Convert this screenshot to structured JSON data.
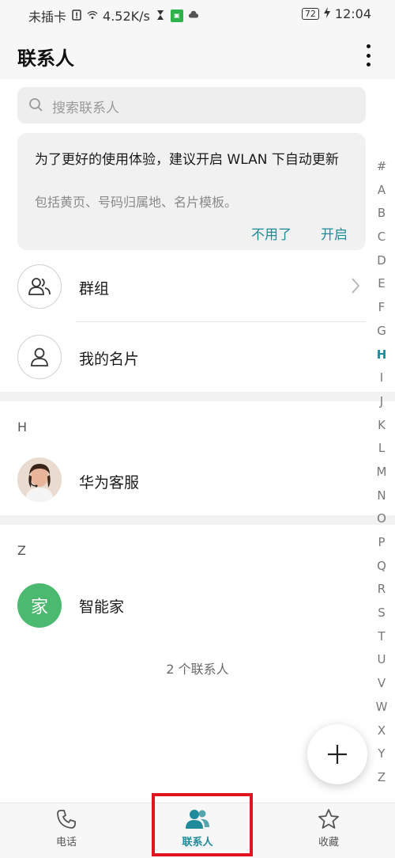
{
  "status_bar": {
    "carrier": "未插卡",
    "speed": "4.52K/s",
    "battery": "72",
    "time": "12:04"
  },
  "header": {
    "title": "联系人",
    "menu_icon": "more-vertical-icon"
  },
  "search": {
    "placeholder": "搜索联系人"
  },
  "notice": {
    "message": "为了更好的使用体验，建议开启 WLAN 下自动更新",
    "sub": "包括黄页、号码归属地、名片模板。",
    "dismiss": "不用了",
    "enable": "开启"
  },
  "rows": {
    "groups": "群组",
    "my_card": "我的名片"
  },
  "sections": [
    {
      "letter": "H",
      "contact": "华为客服"
    },
    {
      "letter": "Z",
      "contact": "智能家",
      "avatar_text": "家"
    }
  ],
  "contact_count": "2 个联系人",
  "index_letters": [
    "#",
    "A",
    "B",
    "C",
    "D",
    "E",
    "F",
    "G",
    "H",
    "I",
    "J",
    "K",
    "L",
    "M",
    "N",
    "O",
    "P",
    "Q",
    "R",
    "S",
    "T",
    "U",
    "V",
    "W",
    "X",
    "Y",
    "Z"
  ],
  "active_index": "H",
  "bottom_nav": {
    "phone": "电话",
    "contacts": "联系人",
    "favorites": "收藏"
  },
  "colors": {
    "accent": "#1f8a9a",
    "highlight": "#e0141e",
    "avatar_green": "#4cb970"
  }
}
